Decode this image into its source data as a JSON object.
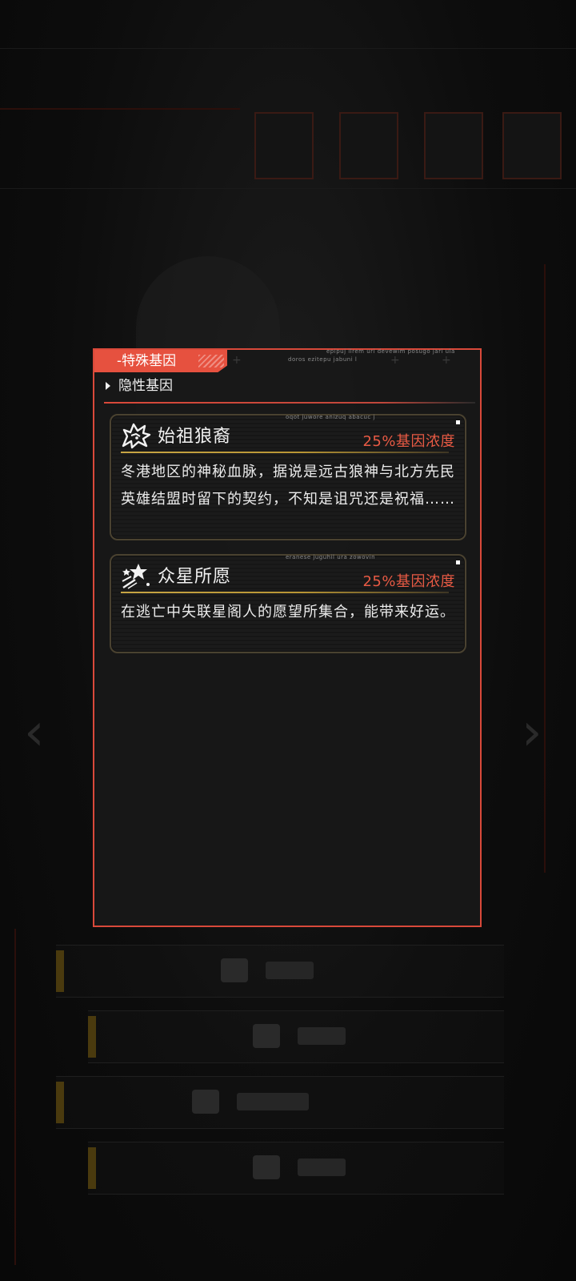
{
  "panel": {
    "tab_label": "-特殊基因",
    "deco_text_1": "epipuj ilrem uri devewim posugo jari ula",
    "deco_text_2": "doros ezitepu jabuni l",
    "section_label": "隐性基因"
  },
  "genes": [
    {
      "name": "始祖狼裔",
      "concentration": "25%基因浓度",
      "description": "冬港地区的神秘血脉，据说是远古狼神与北方先民英雄结盟时留下的契约，不知是诅咒还是祝福……",
      "deco": "oqot juwore anizuq abacuc j",
      "icon": "wolf-icon"
    },
    {
      "name": "众星所愿",
      "concentration": "25%基因浓度",
      "description": "在逃亡中失联星阁人的愿望所集合，能带来好运。",
      "deco": "eranese juguhil ura zowovin",
      "icon": "stars-icon"
    }
  ],
  "colors": {
    "accent": "#e6513f",
    "gold": "#c7a544",
    "concentration": "#e85a44"
  }
}
